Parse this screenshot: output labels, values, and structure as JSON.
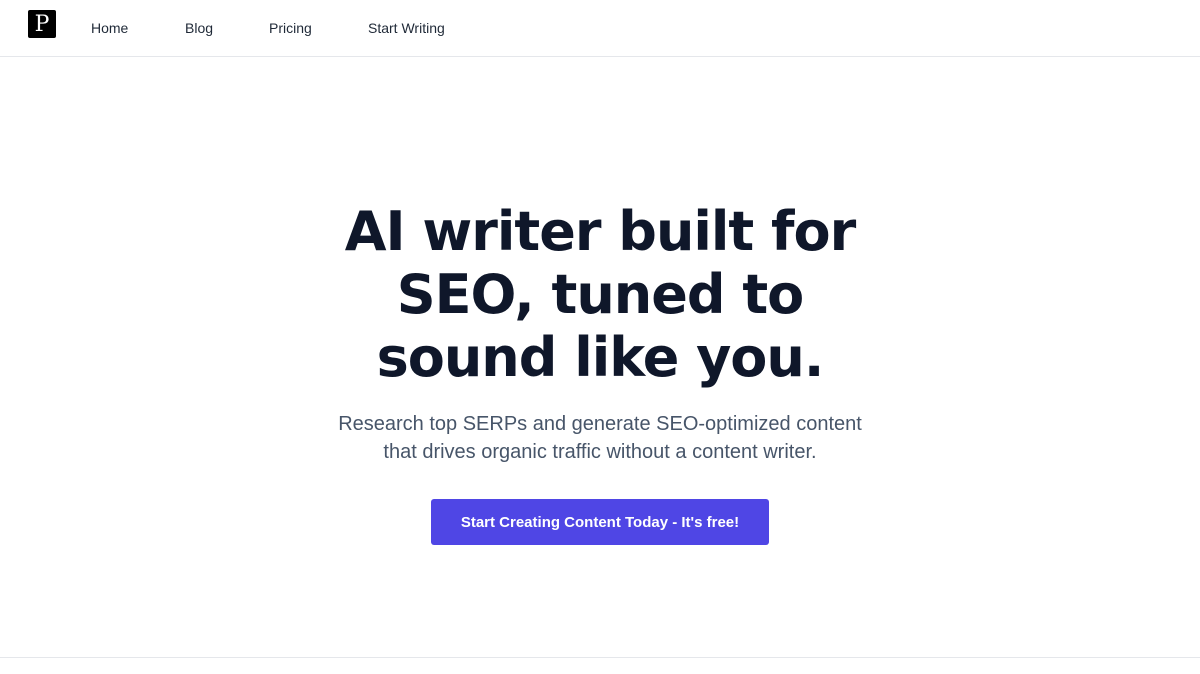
{
  "header": {
    "logo_letter": "P",
    "nav": {
      "home": "Home",
      "blog": "Blog",
      "pricing": "Pricing",
      "start_writing": "Start Writing"
    }
  },
  "hero": {
    "title_lines": [
      "AI writer built for",
      "SEO, tuned to",
      "sound like you."
    ],
    "subtitle_lines": [
      "Research top SERPs and generate SEO-optimized content",
      "that drives organic traffic without a content writer."
    ],
    "cta_label": "Start Creating Content Today - It's free!"
  },
  "colors": {
    "accent": "#4f46e5",
    "heading": "#0f172a",
    "body": "#475569",
    "divider": "#e5e7eb"
  }
}
